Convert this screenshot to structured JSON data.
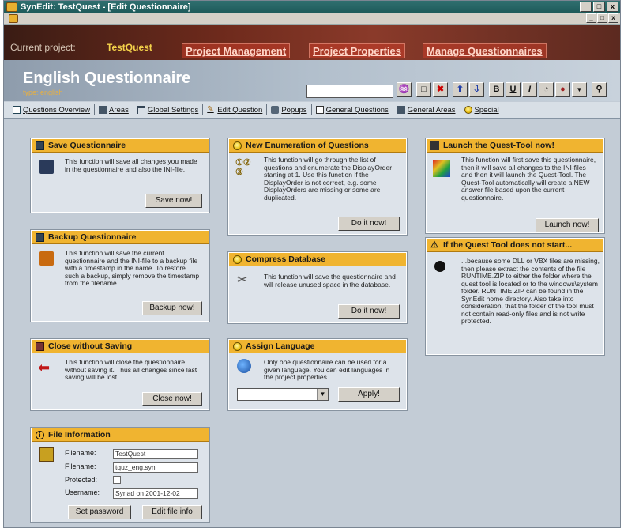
{
  "window": {
    "title": "SynEdit: TestQuest - [Edit Questionnaire]",
    "buttons": [
      "_",
      "□",
      "x"
    ],
    "mdi_buttons": [
      "_",
      "□",
      "x"
    ]
  },
  "project": {
    "label": "Current project:",
    "name": "TestQuest",
    "nav": [
      "Project Management",
      "Project Properties",
      "Manage Questionnaires"
    ]
  },
  "header": {
    "title": "English Questionnaire",
    "subtitle": "type: english",
    "search_value": ""
  },
  "tabs": [
    {
      "label": "Questions Overview",
      "icon": "list-icon"
    },
    {
      "label": "Areas",
      "icon": "areas-icon"
    },
    {
      "label": "Global Settings",
      "icon": "settings-icon"
    },
    {
      "label": "Edit Question",
      "icon": "pencil-icon"
    },
    {
      "label": "Popups",
      "icon": "popup-icon"
    },
    {
      "label": "General Questions",
      "icon": "page-icon"
    },
    {
      "label": "General Areas",
      "icon": "areas-icon"
    },
    {
      "label": "Special",
      "icon": "bulb-icon"
    }
  ],
  "panels": {
    "save": {
      "title": "Save Questionnaire",
      "text": "This function will save all changes you made in the questionnaire and also the INI-file.",
      "button": "Save now!"
    },
    "backup": {
      "title": "Backup Questionnaire",
      "text": "This function will save the current questionnaire and the INI-file to a backup file with a timestamp in the name. To restore such a backup, simply remove the timestamp from the filename.",
      "button": "Backup now!"
    },
    "close": {
      "title": "Close without Saving",
      "text": "This function will close the questionnaire without saving it. Thus all changes since last saving will be lost.",
      "button": "Close now!"
    },
    "fileinfo": {
      "title": "File Information",
      "labels": {
        "filename": "Filename:",
        "filenamepath": "Filename:",
        "protected": "Protected:",
        "username": "Username:"
      },
      "values": {
        "filename": "TestQuest",
        "filenamepath": "tquz_eng.syn",
        "username": "Synad on 2001-12-02"
      },
      "buttons": {
        "password": "Set password",
        "edit": "Edit file info"
      }
    },
    "enumeration": {
      "title": "New Enumeration of Questions",
      "text": "This function will go through the list of questions and enumerate the DisplayOrder starting at 1. Use this function if the DisplayOrder is not correct, e.g. some DisplayOrders are missing or some are duplicated.",
      "button": "Do it now!"
    },
    "compress": {
      "title": "Compress Database",
      "text": "This function will save the questionnaire and will release unused space in the database.",
      "button": "Do it now!"
    },
    "language": {
      "title": "Assign Language",
      "text": "Only one questionnaire can be used for a given language. You can edit languages in the project properties.",
      "select_value": "",
      "button": "Apply!"
    },
    "launch": {
      "title": "Launch the Quest-Tool now!",
      "text": "This function will first save this questionnaire, then it will save all changes to the INI-files and then it will launch the Quest-Tool. The Quest-Tool automatically will create a NEW answer file based upon the current questionnaire.",
      "button": "Launch now!"
    },
    "trouble": {
      "title": "If the Quest Tool does not start...",
      "text": "...because some DLL or VBX files are missing, then please extract the contents of the file RUNTIME.ZIP to either the folder where the quest tool is located or to the windows\\system folder. RUNTIME.ZIP can be found in the SynEdit home directory. Also take into consideration, that the folder of the tool must not contain read-only files and is not write protected."
    }
  },
  "colors": {
    "panel_header": "#f0b430",
    "background": "#c3ccd6",
    "title_bar": "#1d5a5a"
  }
}
